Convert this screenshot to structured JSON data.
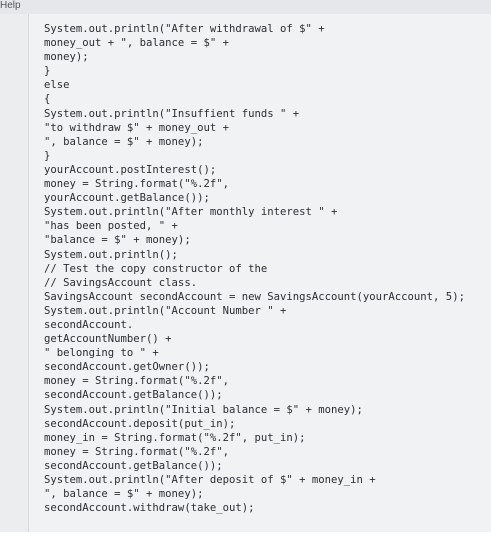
{
  "menubar": {
    "help_label": "Help"
  },
  "code_lines": [
    "System.out.println(\"After withdrawal of $\" +",
    "money_out + \", balance = $\" +",
    "money);",
    "}",
    "else",
    "{",
    "System.out.println(\"Insuffient funds \" +",
    "\"to withdraw $\" + money_out +",
    "\", balance = $\" + money);",
    "}",
    "yourAccount.postInterest();",
    "money = String.format(\"%.2f\",",
    "yourAccount.getBalance());",
    "System.out.println(\"After monthly interest \" +",
    "\"has been posted, \" +",
    "\"balance = $\" + money);",
    "System.out.println();",
    "// Test the copy constructor of the",
    "// SavingsAccount class.",
    "SavingsAccount secondAccount = new SavingsAccount(yourAccount, 5);",
    "System.out.println(\"Account Number \" +",
    "secondAccount.",
    "getAccountNumber() +",
    "\" belonging to \" +",
    "secondAccount.getOwner());",
    "money = String.format(\"%.2f\",",
    "secondAccount.getBalance());",
    "System.out.println(\"Initial balance = $\" + money);",
    "secondAccount.deposit(put_in);",
    "money_in = String.format(\"%.2f\", put_in);",
    "money = String.format(\"%.2f\",",
    "secondAccount.getBalance());",
    "System.out.println(\"After deposit of $\" + money_in +",
    "\", balance = $\" + money);",
    "secondAccount.withdraw(take_out);"
  ]
}
